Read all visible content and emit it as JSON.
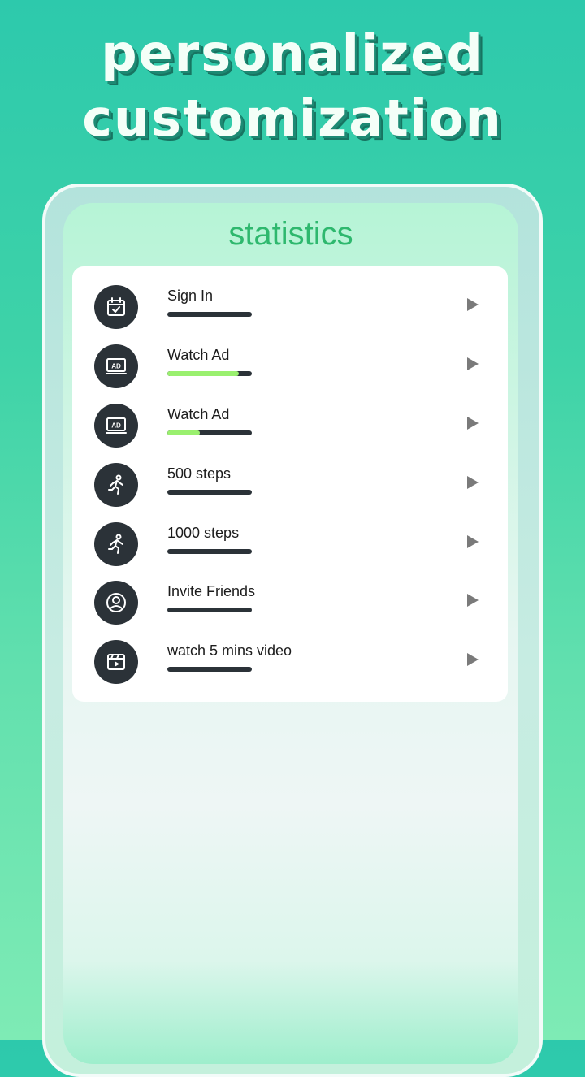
{
  "banner": {
    "line1": "personalized",
    "line2": "customization"
  },
  "screen": {
    "title": "statistics"
  },
  "tasks": [
    {
      "label": "Sign In",
      "icon": "calendar-check-icon",
      "progress": 0
    },
    {
      "label": "Watch Ad",
      "icon": "ad-icon",
      "progress": 0.85
    },
    {
      "label": "Watch Ad",
      "icon": "ad-icon",
      "progress": 0.38
    },
    {
      "label": "500 steps",
      "icon": "running-icon",
      "progress": 0
    },
    {
      "label": "1000 steps",
      "icon": "running-icon",
      "progress": 0
    },
    {
      "label": "Invite Friends",
      "icon": "user-icon",
      "progress": 0
    },
    {
      "label": "watch 5 mins video",
      "icon": "video-icon",
      "progress": 0
    }
  ],
  "colors": {
    "accent_green": "#2eb86e",
    "progress_fill": "#9af06f",
    "progress_track": "#2b3238",
    "icon_bg": "#2b3238"
  }
}
